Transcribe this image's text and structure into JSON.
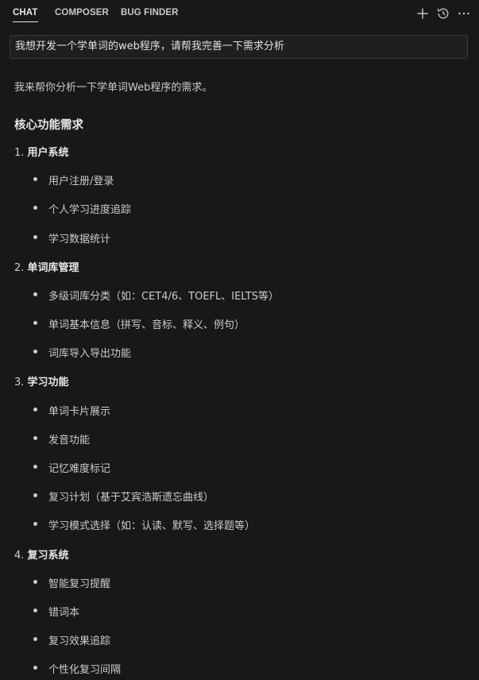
{
  "tabs": [
    {
      "label": "CHAT",
      "active": true
    },
    {
      "label": "COMPOSER",
      "active": false
    },
    {
      "label": "BUG FINDER",
      "active": false
    }
  ],
  "toolbar_icons": [
    "plus-icon",
    "history-icon",
    "more-icon"
  ],
  "prompt": {
    "text": "我想开发一个学单词的web程序，请帮我完善一下需求分析"
  },
  "response": {
    "intro": "我来帮你分析一下学单词Web程序的需求。",
    "heading": "核心功能需求",
    "sections": [
      {
        "number": "1.",
        "title": "用户系统",
        "items": [
          "用户注册/登录",
          "个人学习进度追踪",
          "学习数据统计"
        ]
      },
      {
        "number": "2.",
        "title": "单词库管理",
        "items": [
          "多级词库分类（如：CET4/6、TOEFL、IELTS等）",
          "单词基本信息（拼写、音标、释义、例句）",
          "词库导入导出功能"
        ]
      },
      {
        "number": "3.",
        "title": "学习功能",
        "items": [
          "单词卡片展示",
          "发音功能",
          "记忆难度标记",
          "复习计划（基于艾宾浩斯遗忘曲线）",
          "学习模式选择（如：认读、默写、选择题等）"
        ]
      },
      {
        "number": "4.",
        "title": "复习系统",
        "items": [
          "智能复习提醒",
          "错词本",
          "复习效果追踪",
          "个性化复习间隔"
        ]
      }
    ]
  },
  "colors": {
    "background": "#181818",
    "input_background": "#1f1f1f",
    "text": "#cccccc",
    "heading_text": "#e6e6e6"
  }
}
